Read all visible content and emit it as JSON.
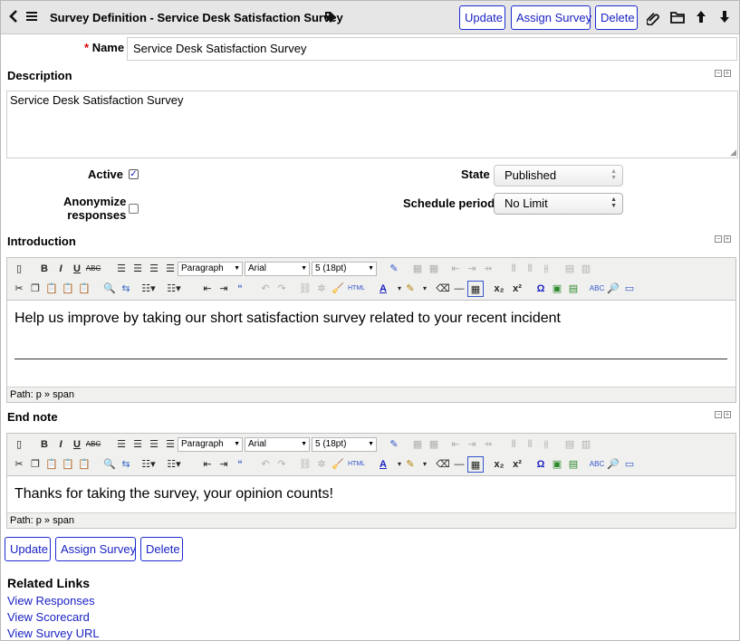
{
  "header": {
    "back_icon": "back-chevron-icon",
    "menu_icon": "hamburger-menu-icon",
    "title": "Survey Definition - Service Desk Satisfaction Survey",
    "tag_icon": "tag-icon",
    "update_label": "Update",
    "assign_label": "Assign Survey",
    "delete_label": "Delete",
    "icons": [
      "paperclip-icon",
      "folder-icon",
      "arrow-up-icon",
      "arrow-down-icon"
    ]
  },
  "form": {
    "name_required": "*",
    "name_label": "Name",
    "name_value": "Service Desk Satisfaction Survey",
    "description_label": "Description",
    "description_value": "Service Desk Satisfaction Survey",
    "active_label": "Active",
    "active_checked": true,
    "anonymize_label_line1": "Anonymize",
    "anonymize_label_line2": "responses",
    "anonymize_checked": false,
    "state_label": "State",
    "state_value": "Published",
    "schedule_label": "Schedule period",
    "schedule_value": "No Limit"
  },
  "editor_toolbar": {
    "format": "Paragraph",
    "font": "Arial",
    "size": "5 (18pt)"
  },
  "introduction": {
    "label": "Introduction",
    "content": "Help us improve by taking our short satisfaction survey related to your recent incident",
    "path": "Path: p » span"
  },
  "end_note": {
    "label": "End note",
    "content": "Thanks for taking the survey, your opinion counts!",
    "path": "Path: p » span"
  },
  "footer": {
    "update_label": "Update",
    "assign_label": "Assign Survey",
    "delete_label": "Delete"
  },
  "related_links": {
    "title": "Related Links",
    "links": [
      "View Responses",
      "View Scorecard",
      "View Survey URL"
    ]
  },
  "colors": {
    "button_border": "#1d2bd1",
    "link": "#1a22c4",
    "header_bg": "#e6e6e6",
    "required": "#dd0000"
  }
}
